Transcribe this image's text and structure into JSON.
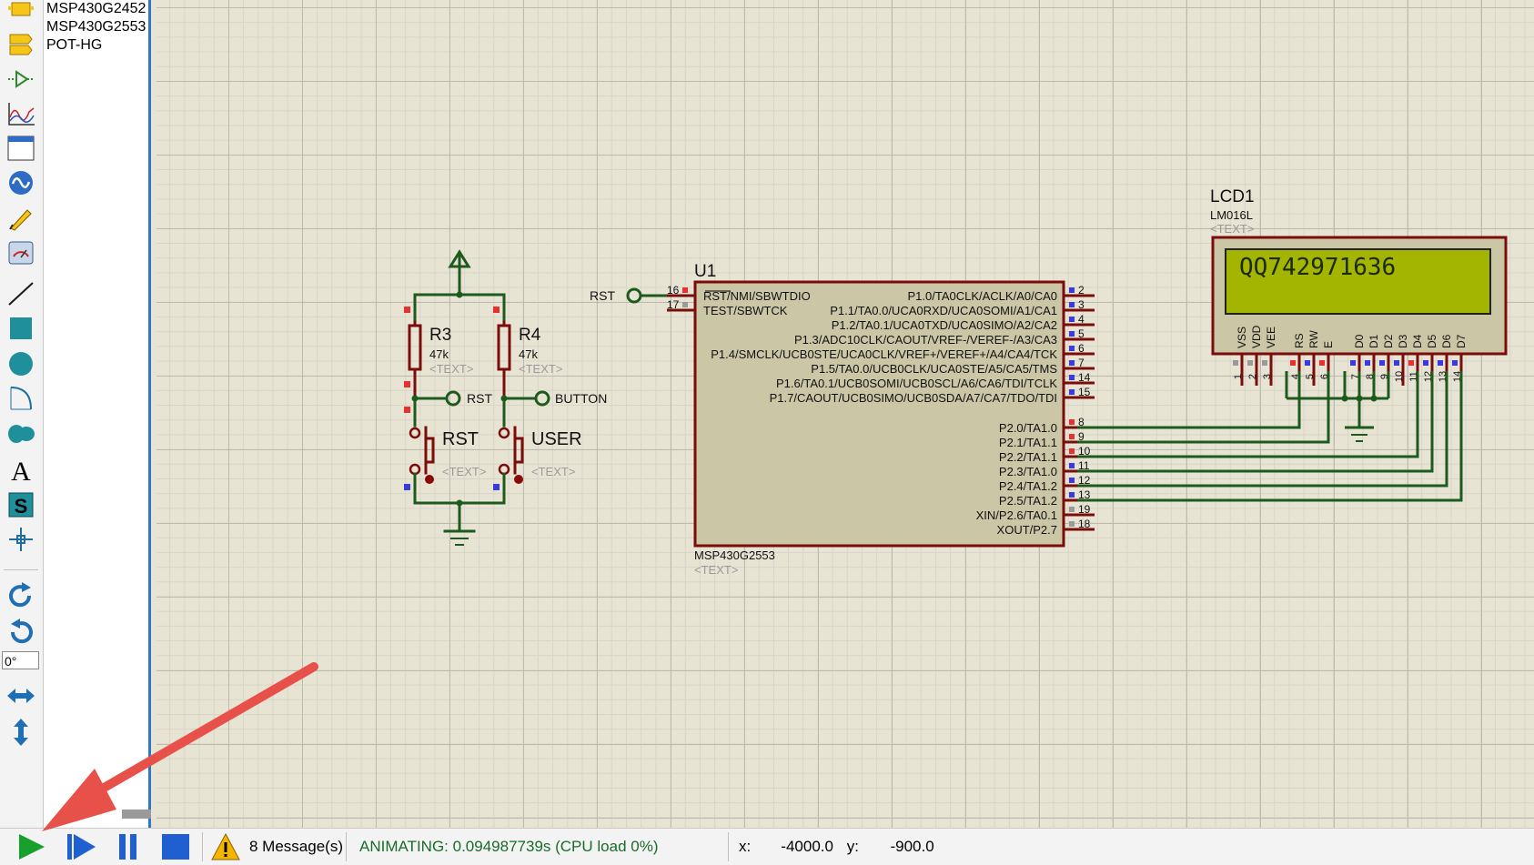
{
  "device_list": [
    "MSP430G2452",
    "MSP430G2553",
    "POT-HG"
  ],
  "toolbar": {
    "tools": [
      "component-tool",
      "terminal-tool",
      "port-tool",
      "graph-tool",
      "recorder-tool",
      "generator-tool",
      "probe-tool",
      "virtual-instrument-tool",
      "line-tool",
      "box-tool",
      "circle-tool",
      "arc-tool",
      "path-tool",
      "text-tool",
      "symbol-tool",
      "marker-tool",
      "rotate-clockwise",
      "rotate-anticlockwise",
      "mirror-horizontal",
      "mirror-vertical"
    ],
    "angle": "0°"
  },
  "schematic": {
    "r3": {
      "ref": "R3",
      "value": "47k",
      "text": "<TEXT>"
    },
    "r4": {
      "ref": "R4",
      "value": "47k",
      "text": "<TEXT>"
    },
    "rst_button": {
      "ref": "RST",
      "text": "<TEXT>"
    },
    "user_button": {
      "ref": "USER",
      "text": "<TEXT>"
    },
    "terminals": {
      "rst_a": "RST",
      "rst_b": "RST",
      "button": "BUTTON"
    },
    "u1": {
      "ref": "U1",
      "part": "MSP430G2553",
      "text": "<TEXT>",
      "left_pins": [
        {
          "num": "16",
          "name": "RST/NMI/SBWTDIO"
        },
        {
          "num": "17",
          "name": "TEST/SBWTCK"
        }
      ],
      "right_pins": [
        {
          "num": "2",
          "name": "P1.0/TA0CLK/ACLK/A0/CA0"
        },
        {
          "num": "3",
          "name": "P1.1/TA0.0/UCA0RXD/UCA0SOMI/A1/CA1"
        },
        {
          "num": "4",
          "name": "P1.2/TA0.1/UCA0TXD/UCA0SIMO/A2/CA2"
        },
        {
          "num": "5",
          "name": "P1.3/ADC10CLK/CAOUT/VREF-/VEREF-/A3/CA3"
        },
        {
          "num": "6",
          "name": "P1.4/SMCLK/UCB0STE/UCA0CLK/VREF+/VEREF+/A4/CA4/TCK"
        },
        {
          "num": "7",
          "name": "P1.5/TA0.0/UCB0CLK/UCA0STE/A5/CA5/TMS"
        },
        {
          "num": "14",
          "name": "P1.6/TA0.1/UCB0SOMI/UCB0SCL/A6/CA6/TDI/TCLK"
        },
        {
          "num": "15",
          "name": "P1.7/CAOUT/UCB0SIMO/UCB0SDA/A7/CA7/TDO/TDI"
        },
        {
          "num": "8",
          "name": "P2.0/TA1.0"
        },
        {
          "num": "9",
          "name": "P2.1/TA1.1"
        },
        {
          "num": "10",
          "name": "P2.2/TA1.1"
        },
        {
          "num": "11",
          "name": "P2.3/TA1.0"
        },
        {
          "num": "12",
          "name": "P2.4/TA1.2"
        },
        {
          "num": "13",
          "name": "P2.5/TA1.2"
        },
        {
          "num": "19",
          "name": "XIN/P2.6/TA0.1"
        },
        {
          "num": "18",
          "name": "XOUT/P2.7"
        }
      ]
    },
    "lcd": {
      "ref": "LCD1",
      "part": "LM016L",
      "text": "<TEXT>",
      "display": "QQ742971636",
      "pins": [
        {
          "name": "VSS",
          "num": "1"
        },
        {
          "name": "VDD",
          "num": "2"
        },
        {
          "name": "VEE",
          "num": "3"
        },
        {
          "name": "RS",
          "num": "4"
        },
        {
          "name": "RW",
          "num": "5"
        },
        {
          "name": "E",
          "num": "6"
        },
        {
          "name": "D0",
          "num": "7"
        },
        {
          "name": "D1",
          "num": "8"
        },
        {
          "name": "D2",
          "num": "9"
        },
        {
          "name": "D3",
          "num": "10"
        },
        {
          "name": "D4",
          "num": "11"
        },
        {
          "name": "D5",
          "num": "12"
        },
        {
          "name": "D6",
          "num": "13"
        },
        {
          "name": "D7",
          "num": "14"
        }
      ]
    }
  },
  "status": {
    "messages": "8 Message(s)",
    "animating": "ANIMATING: 0.094987739s (CPU load 0%)",
    "x_label": "x:",
    "x_value": "-4000.0",
    "y_label": "y:",
    "y_value": "-900.0"
  },
  "colors": {
    "wire": "#1e5a1e",
    "component": "#7a0c0c",
    "pin_high": "#e83030",
    "pin_low": "#3a3ae0",
    "lcd_screen": "#a3b500",
    "arrow": "#e8504a",
    "status_green": "#1a6b2a"
  }
}
